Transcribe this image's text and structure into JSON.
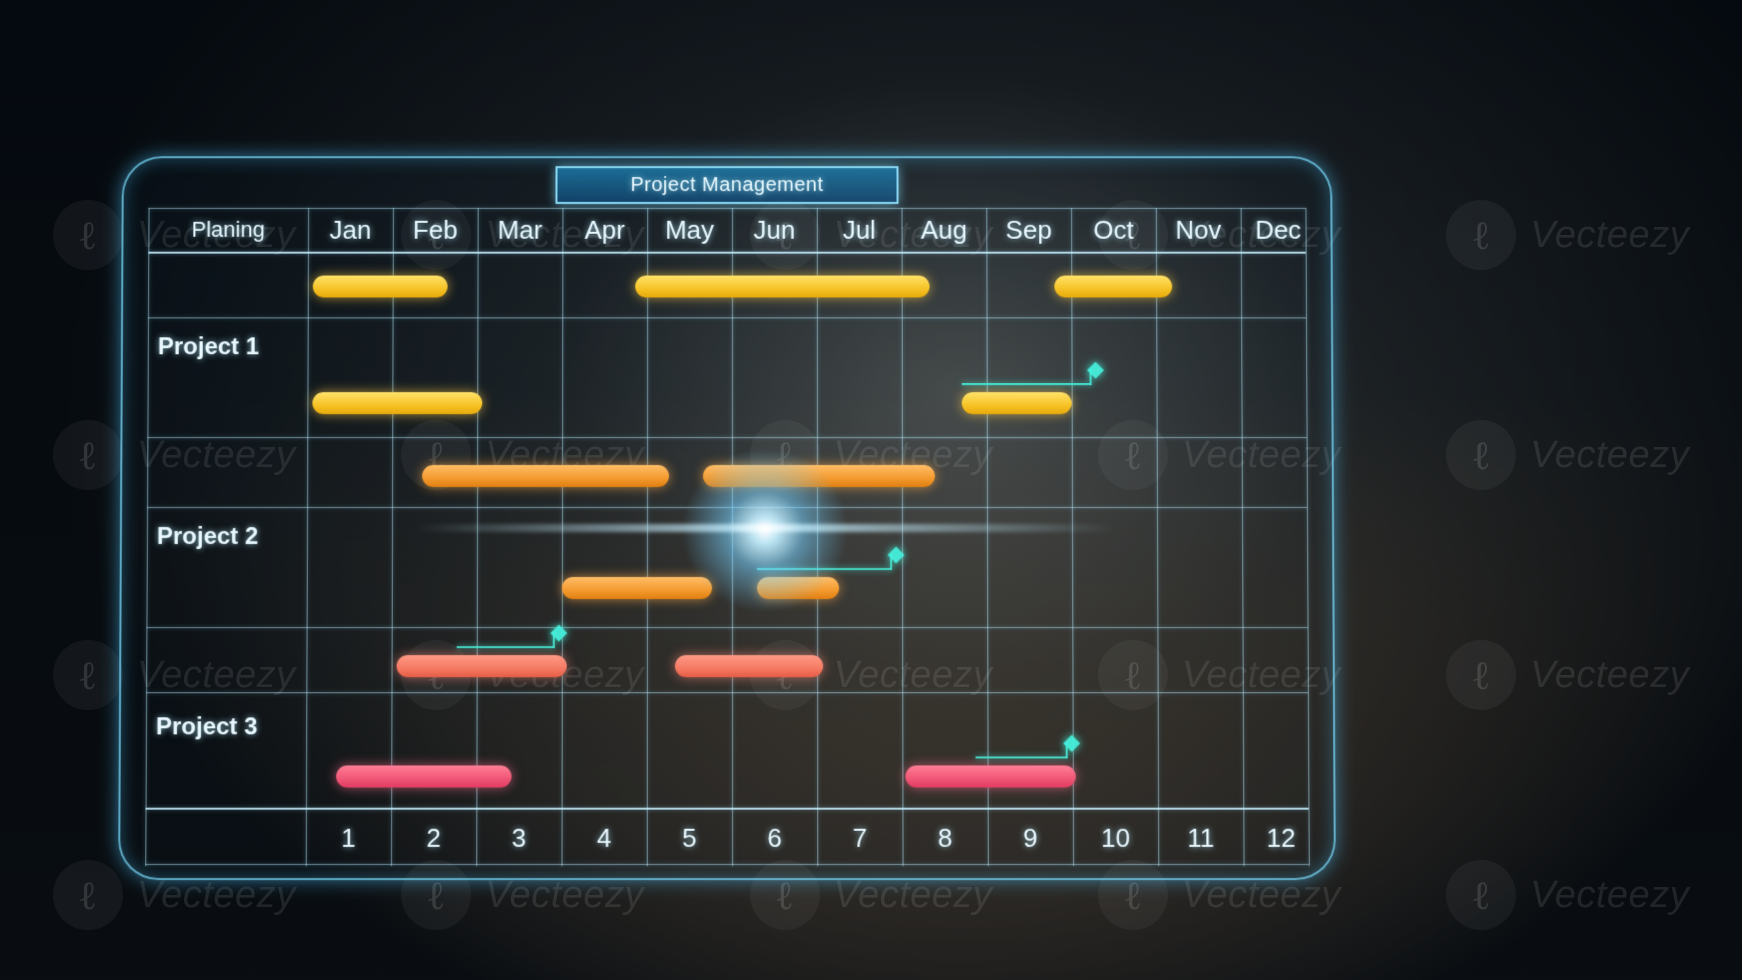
{
  "watermark_text": "Vecteezy",
  "title": "Project Management",
  "label_column_header": "Planing",
  "months": [
    "Jan",
    "Feb",
    "Mar",
    "Apr",
    "May",
    "Jun",
    "Jul",
    "Aug",
    "Sep",
    "Oct",
    "Nov",
    "Dec"
  ],
  "footer_numbers": [
    "1",
    "2",
    "3",
    "4",
    "5",
    "6",
    "7",
    "8",
    "9",
    "10",
    "11",
    "12"
  ],
  "rows": [
    {
      "label": "Project 1"
    },
    {
      "label": "Project 2"
    },
    {
      "label": "Project 3"
    }
  ],
  "colors": {
    "yellow": "#f6c326",
    "orange": "#f49a2e",
    "salmon": "#f47a64",
    "pink": "#f05676",
    "milestone": "#46e6d2"
  },
  "chart_data": {
    "type": "bar",
    "title": "Project Management",
    "xlabel": "",
    "ylabel": "",
    "categories": [
      "Jan",
      "Feb",
      "Mar",
      "Apr",
      "May",
      "Jun",
      "Jul",
      "Aug",
      "Sep",
      "Oct",
      "Nov",
      "Dec"
    ],
    "x": [
      1,
      2,
      3,
      4,
      5,
      6,
      7,
      8,
      9,
      10,
      11,
      12
    ],
    "xlim": [
      1,
      12
    ],
    "groups": [
      {
        "name": "Project 1",
        "color": "yellow",
        "bars": [
          {
            "track": 0,
            "start": 1.0,
            "end": 2.6
          },
          {
            "track": 0,
            "start": 4.8,
            "end": 8.4
          },
          {
            "track": 0,
            "start": 9.8,
            "end": 11.2
          },
          {
            "track": 1,
            "start": 1.0,
            "end": 3.0
          },
          {
            "track": 1,
            "start": 8.7,
            "end": 10.0
          }
        ],
        "milestones": [
          {
            "track": 1,
            "from": 8.7,
            "to": 10.3
          }
        ]
      },
      {
        "name": "Project 2",
        "color": "orange",
        "bars": [
          {
            "track": 0,
            "start": 2.3,
            "end": 5.2
          },
          {
            "track": 0,
            "start": 5.6,
            "end": 8.4
          },
          {
            "track": 1,
            "start": 4.0,
            "end": 5.8
          },
          {
            "track": 1,
            "start": 6.3,
            "end": 7.3
          }
        ],
        "milestones": [
          {
            "track": 1,
            "from": 6.3,
            "to": 8.0
          }
        ]
      },
      {
        "name": "Project 3",
        "color_tracks": [
          "salmon",
          "pink"
        ],
        "bars": [
          {
            "track": 0,
            "start": 2.0,
            "end": 4.0,
            "color": "salmon"
          },
          {
            "track": 0,
            "start": 5.3,
            "end": 7.0,
            "color": "salmon"
          },
          {
            "track": 1,
            "start": 1.3,
            "end": 3.3,
            "color": "pink"
          },
          {
            "track": 1,
            "start": 8.0,
            "end": 10.0,
            "color": "pink"
          }
        ],
        "milestones": [
          {
            "track": 0,
            "from": 2.7,
            "to": 4.0
          },
          {
            "track": 1,
            "from": 8.8,
            "to": 10.0
          }
        ]
      }
    ]
  }
}
